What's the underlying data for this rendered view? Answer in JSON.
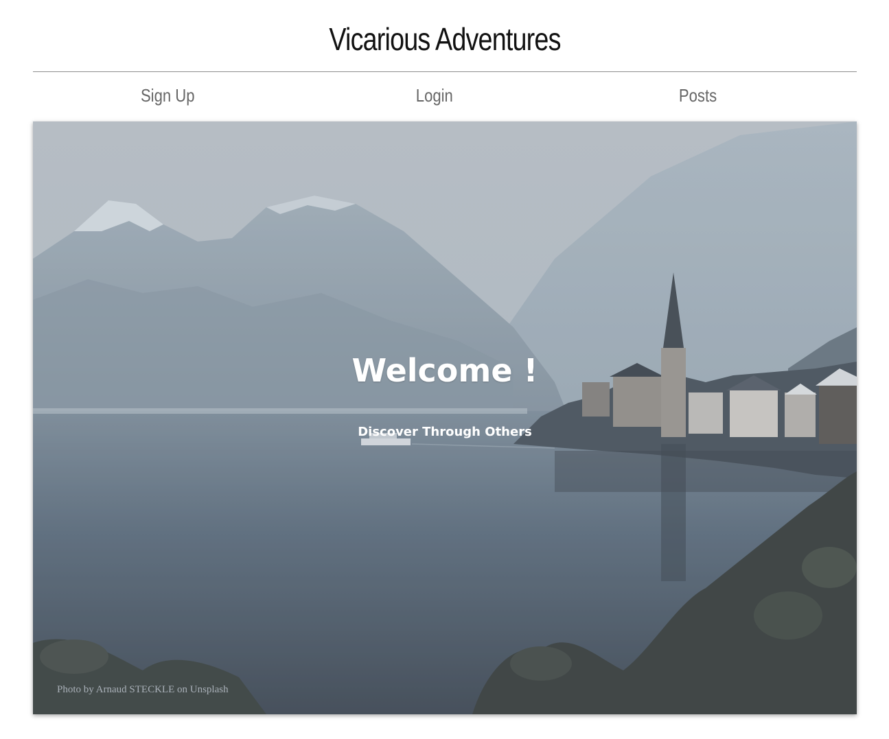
{
  "header": {
    "title": "Vicarious Adventures"
  },
  "nav": {
    "items": [
      {
        "label": "Sign Up"
      },
      {
        "label": "Login"
      },
      {
        "label": "Posts"
      }
    ]
  },
  "hero": {
    "title": "Welcome !",
    "subtitle": "Discover Through Others",
    "credit": "Photo by Arnaud STECKLE on Unsplash"
  }
}
